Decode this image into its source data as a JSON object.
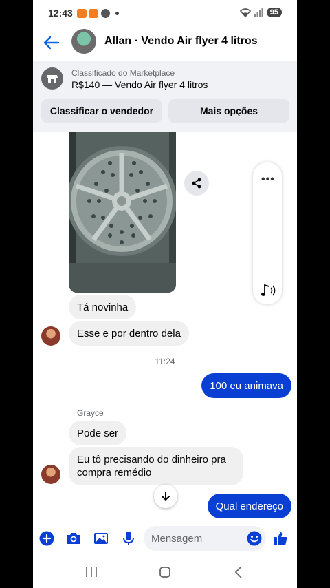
{
  "status_bar": {
    "time": "12:43",
    "battery": "95"
  },
  "header": {
    "title": "Allan · Vendo Air flyer 4 litros"
  },
  "marketplace": {
    "subtitle": "Classificado do Marketplace",
    "title": "R$140 — Vendo Air flyer 4 litros",
    "rate_seller_label": "Classificar o vendedor",
    "more_options_label": "Mais opções"
  },
  "messages": {
    "msg1": "Tá novinha",
    "msg2": "Esse e por dentro dela",
    "timestamp": "11:24",
    "msg3": "100 eu animava",
    "sender": "Grayce",
    "msg4": "Pode ser",
    "msg5": "Eu tô precisando do dinheiro pra compra remédio",
    "msg6": "Qual endereço"
  },
  "composer": {
    "placeholder": "Mensagem"
  },
  "colors": {
    "accent": "#0a3fd4",
    "incoming_bubble": "#f0f0f0"
  },
  "icons": [
    "back-arrow-icon",
    "marketplace-store-icon",
    "share-icon",
    "more-icon",
    "audio-icon",
    "plus-icon",
    "camera-icon",
    "image-icon",
    "mic-icon",
    "emoji-icon",
    "like-icon",
    "arrow-down-icon"
  ]
}
